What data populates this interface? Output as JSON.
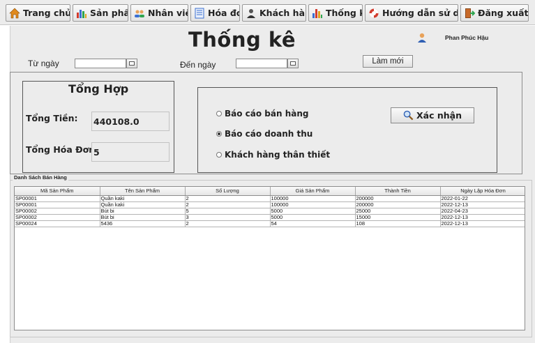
{
  "nav": {
    "items": [
      {
        "label": "Trang chủ",
        "icon": "home-icon"
      },
      {
        "label": "Sản phẩm",
        "icon": "product-chart-icon"
      },
      {
        "label": "Nhân viên",
        "icon": "staff-icon"
      },
      {
        "label": "Hóa đơn",
        "icon": "invoice-icon"
      },
      {
        "label": "Khách hàng",
        "icon": "customer-icon"
      },
      {
        "label": "Thống kê",
        "icon": "statistics-icon"
      },
      {
        "label": "Hướng dẫn sử dụng",
        "icon": "lifebuoy-icon"
      },
      {
        "label": "Đăng xuất",
        "icon": "logout-icon"
      }
    ]
  },
  "header": {
    "title": "Thống kê",
    "user_name": "Phan Phúc Hậu"
  },
  "filter": {
    "from_label": "Từ ngày",
    "from_value": "",
    "to_label": "Đến ngày",
    "to_value": "",
    "refresh_label": "Làm mới"
  },
  "summary": {
    "title": "Tổng Hợp",
    "total_money_label": "Tổng Tiền:",
    "total_money_value": "440108.0",
    "total_invoice_label": "Tổng Hóa Đơn",
    "total_invoice_value": "5"
  },
  "report": {
    "options": [
      {
        "label": "Báo cáo bán hàng",
        "selected": false
      },
      {
        "label": "Báo cáo doanh thu",
        "selected": true
      },
      {
        "label": "Khách hàng thân thiết",
        "selected": false
      }
    ],
    "confirm_label": "Xác nhận"
  },
  "list": {
    "title": "Danh Sách Bán Hàng",
    "columns": [
      "Mã Sản Phẩm",
      "Tên Sản Phẩm",
      "Số Lượng",
      "Giá Sản Phẩm",
      "Thành Tiền",
      "Ngày Lập Hóa Đơn"
    ],
    "rows": [
      [
        "SP00001",
        "Quần kaki",
        "2",
        "100000",
        "200000",
        "2022-01-22"
      ],
      [
        "SP00001",
        "Quần kaki",
        "2",
        "100000",
        "200000",
        "2022-12-13"
      ],
      [
        "SP00002",
        "Bút bi",
        "5",
        "5000",
        "25000",
        "2022-04-23"
      ],
      [
        "SP00002",
        "Bút bi",
        "3",
        "5000",
        "15000",
        "2022-12-13"
      ],
      [
        "SP00024",
        "5436",
        "2",
        "54",
        "108",
        "2022-12-13"
      ]
    ]
  },
  "colors": {
    "panel_bg": "#ececec",
    "border": "#8c8c8c"
  }
}
